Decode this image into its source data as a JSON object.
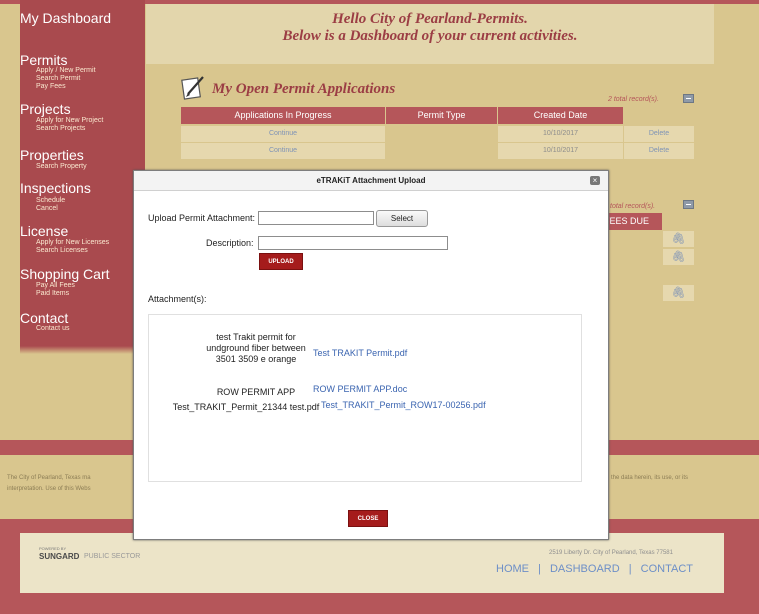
{
  "sidebar": {
    "dashboard": "My Dashboard",
    "sections": [
      {
        "title": "Permits",
        "items": [
          "Apply / New Permit",
          "Search Permit",
          "Pay Fees"
        ]
      },
      {
        "title": "Projects",
        "items": [
          "Apply for New Project",
          "Search Projects"
        ]
      },
      {
        "title": "Properties",
        "items": [
          "Search Property"
        ]
      },
      {
        "title": "Inspections",
        "items": [
          "Schedule",
          "Cancel"
        ]
      },
      {
        "title": "License",
        "items": [
          "Apply for New Licenses",
          "Search Licenses"
        ]
      },
      {
        "title": "Shopping Cart",
        "items": [
          "Pay All Fees",
          "Paid Items"
        ]
      },
      {
        "title": "Contact",
        "items": [
          "Contact us"
        ]
      }
    ]
  },
  "header": {
    "greeting_line1": "Hello City of Pearland-Permits.",
    "greeting_line2": "Below is a Dashboard of your current activities."
  },
  "open_permits": {
    "title": "My Open Permit Applications",
    "records": "2 total record(s).",
    "columns": [
      "Applications In Progress",
      "Permit Type",
      "Created Date"
    ],
    "rows": [
      {
        "action": "Continue",
        "type": "",
        "date": "10/10/2017",
        "delete": "Delete"
      },
      {
        "action": "Continue",
        "type": "",
        "date": "10/10/2017",
        "delete": "Delete"
      }
    ]
  },
  "second_section": {
    "records": "total record(s).",
    "fees_due_header": "FEES DUE"
  },
  "modal": {
    "title": "eTRAKiT Attachment Upload",
    "upload_label": "Upload Permit Attachment:",
    "select_label": "Select",
    "description_label": "Description:",
    "upload_button": "UPLOAD",
    "attachments_label": "Attachment(s):",
    "attachments": [
      {
        "description": "test Trakit permit for undground fiber between 3501 3509 e orange",
        "file": "Test TRAKIT Permit.pdf"
      },
      {
        "description": "ROW PERMIT APP",
        "file": "ROW PERMIT APP.doc"
      },
      {
        "description": "Test_TRAKIT_Permit_21344 test.pdf",
        "file": "Test_TRAKIT_Permit_ROW17-00256.pdf"
      }
    ],
    "close_button": "CLOSE"
  },
  "footer": {
    "disclaimer_left": "The City of Pearland, Texas ma",
    "disclaimer_left2": "interpretation. Use of this Webs",
    "disclaimer_right": "the data herein, its use, or its",
    "powered_by": "POWERED BY",
    "brand": "SUNGARD",
    "brand_suffix": "PUBLIC SECTOR",
    "address": "2519 Liberty Dr. City of Pearland, Texas 77581",
    "links": [
      "HOME",
      "DASHBOARD",
      "CONTACT"
    ],
    "separator": "|"
  },
  "colors": {
    "accent": "#b5565a",
    "link": "#3a64b0",
    "button_red": "#a51c1c"
  }
}
